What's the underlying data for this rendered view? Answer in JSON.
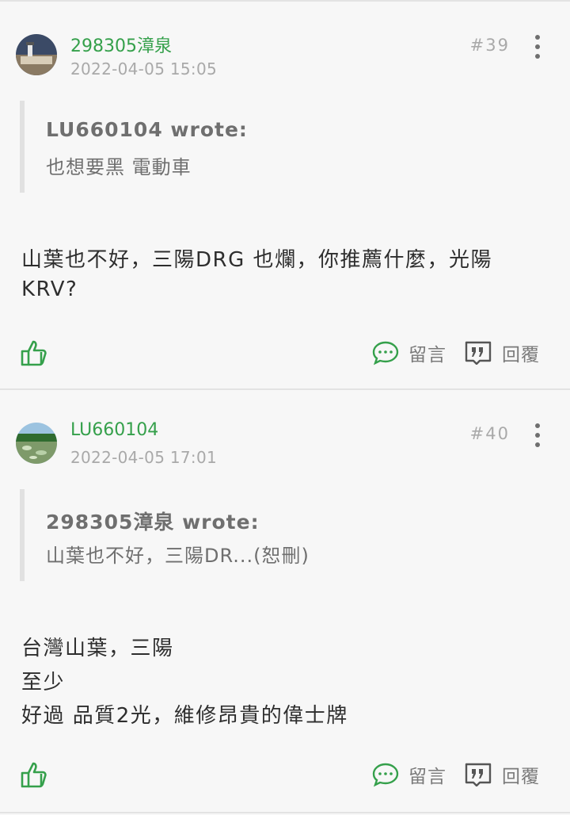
{
  "colors": {
    "accent": "#35a04b",
    "meta": "#a9a9a9",
    "text": "#2e2e2e",
    "quote": "#6f6f6f"
  },
  "posts": [
    {
      "username": "298305漳泉",
      "timestamp": "2022-04-05 15:05",
      "floor": "#39",
      "quote": {
        "author": "LU660104 wrote:",
        "text": "也想要黑 電動車"
      },
      "body": [
        "山葉也不好，三陽DRG 也爛，你推薦什麼，光陽",
        "KRV?"
      ],
      "actions": {
        "comment": "留言",
        "reply": "回覆"
      }
    },
    {
      "username": "LU660104",
      "timestamp": "2022-04-05 17:01",
      "floor": "#40",
      "quote": {
        "author": "298305漳泉 wrote:",
        "text": "山葉也不好，三陽DR...(恕刪)"
      },
      "body": [
        "台灣山葉，三陽",
        "至少",
        "好過 品質2光，維修昂貴的偉士牌"
      ],
      "actions": {
        "comment": "留言",
        "reply": "回覆"
      }
    }
  ]
}
